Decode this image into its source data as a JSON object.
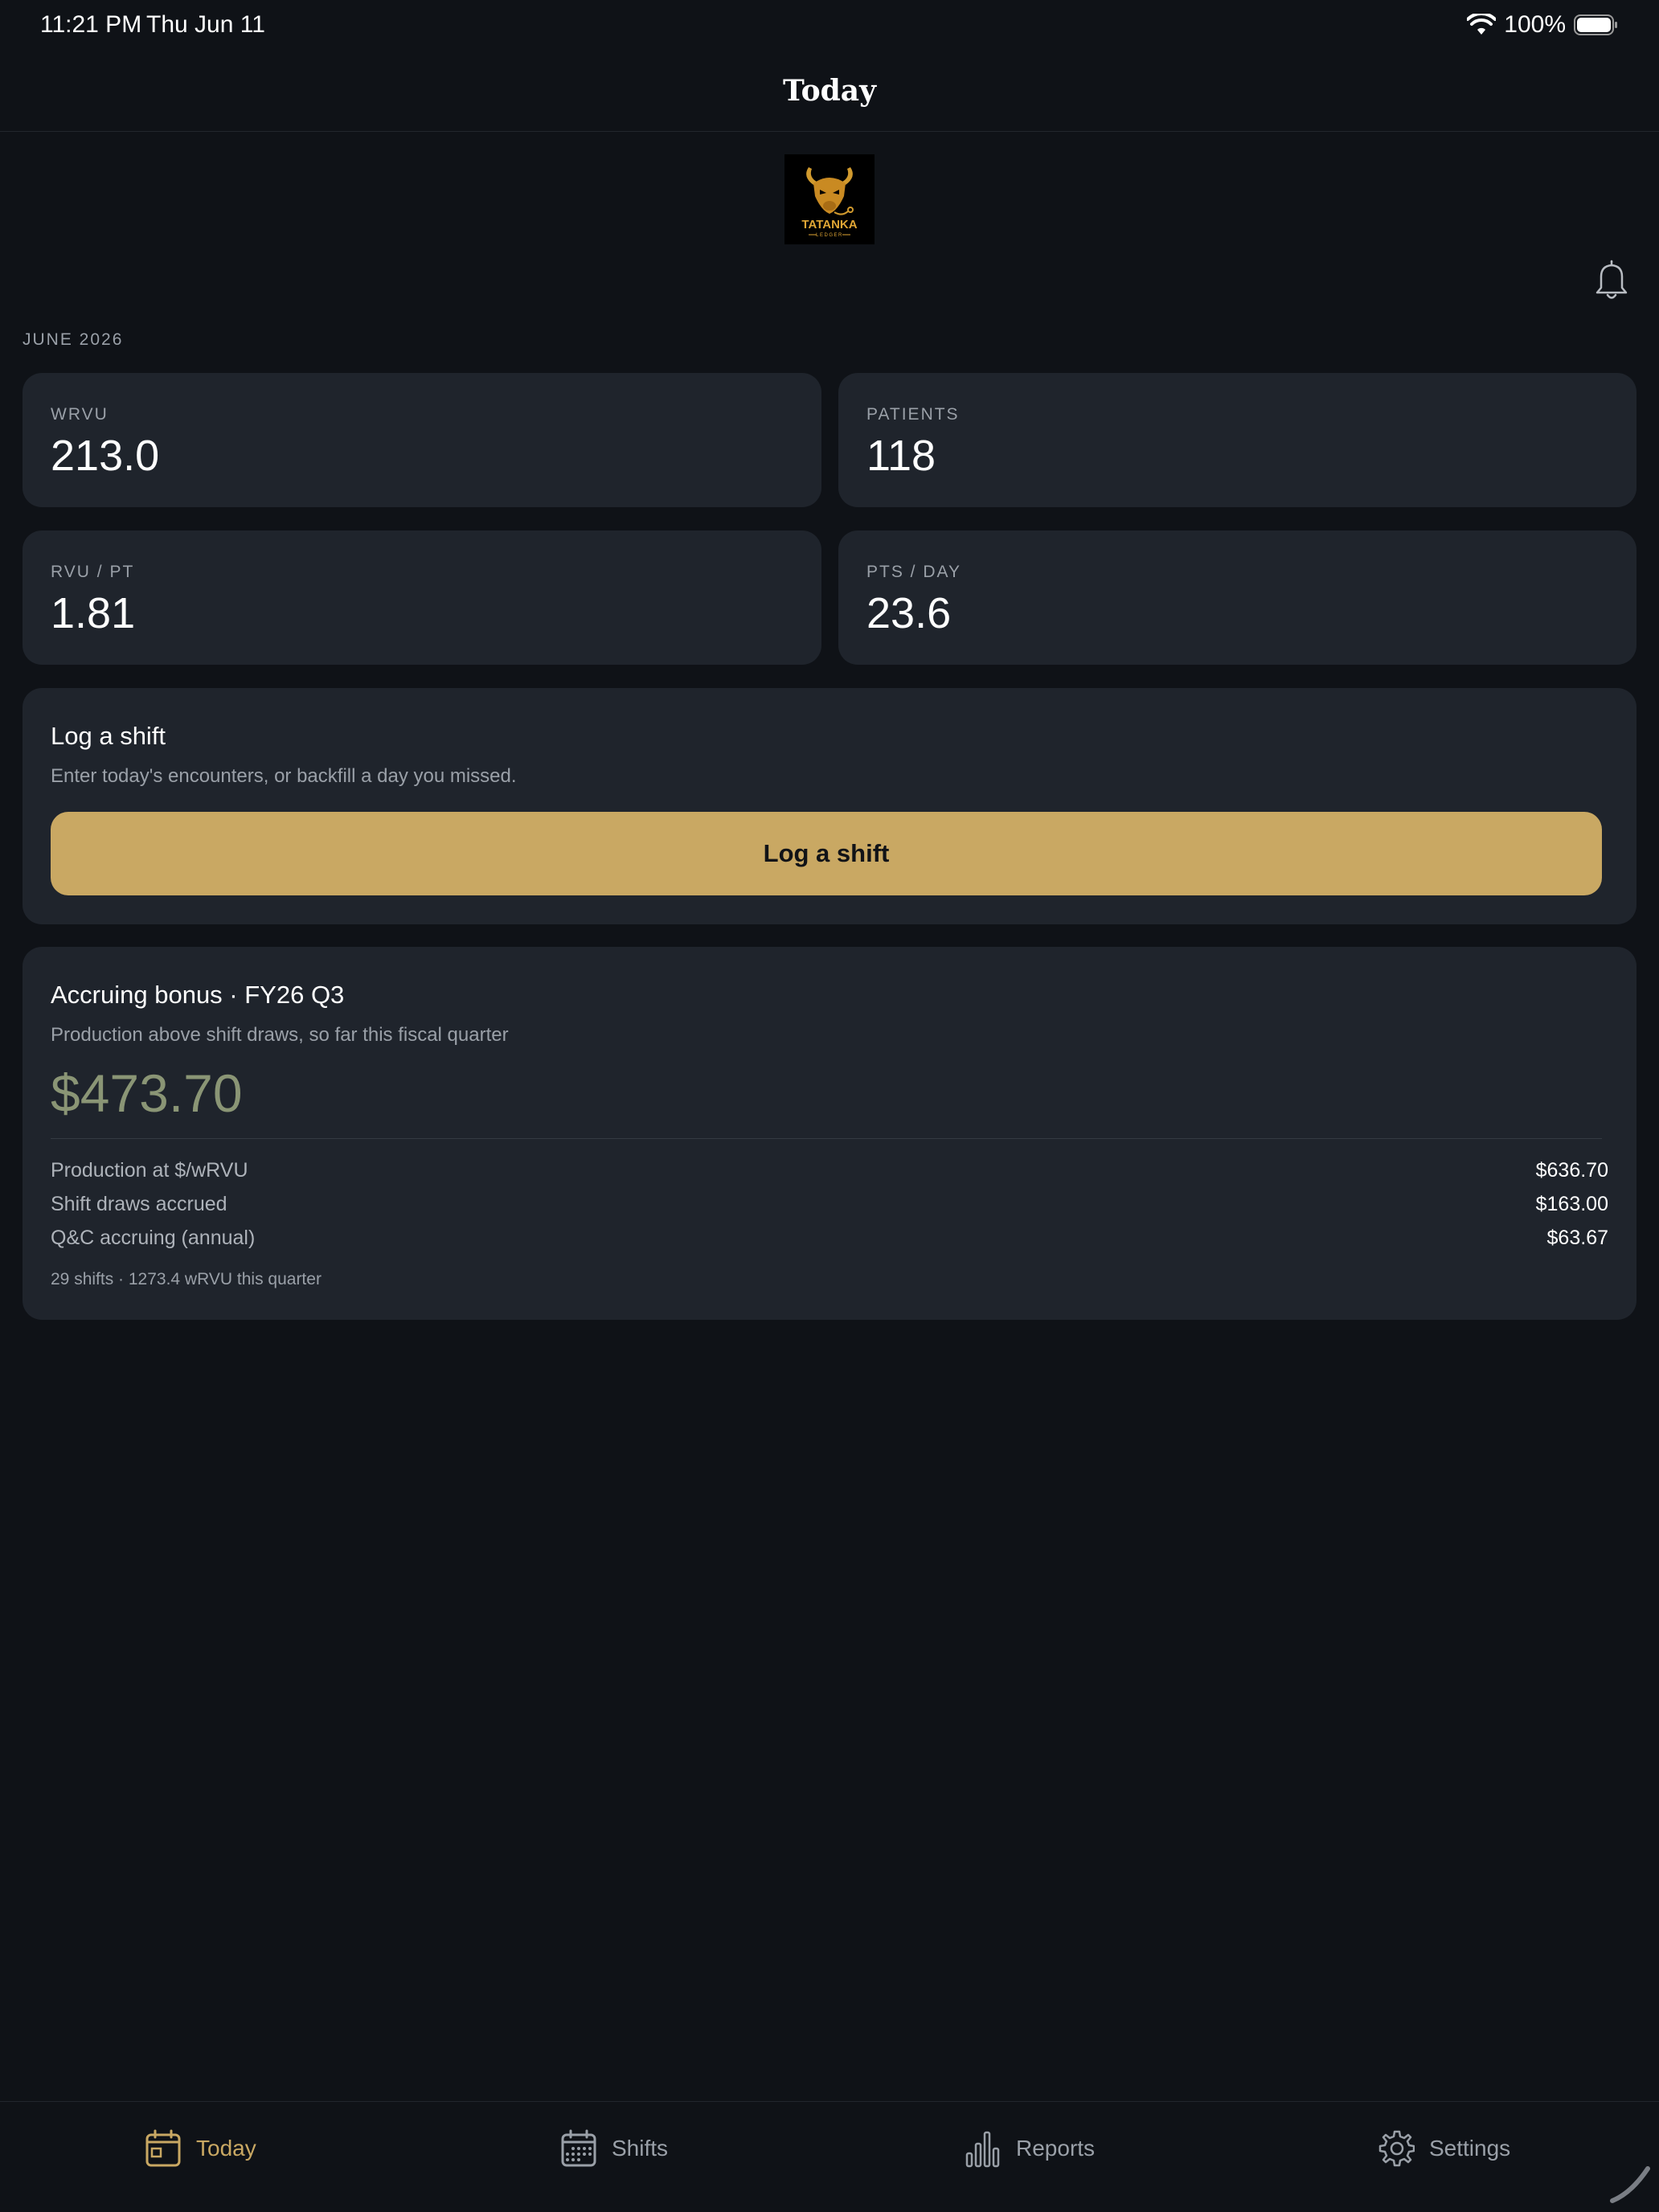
{
  "status_bar": {
    "time": "11:21 PM",
    "date": "Thu Jun 11",
    "battery": "100%"
  },
  "nav": {
    "title": "Today"
  },
  "logo": {
    "brand": "TATANKA",
    "subtitle": "LEDGER"
  },
  "month_label": "JUNE 2026",
  "stats": [
    {
      "label": "WRVU",
      "value": "213.0"
    },
    {
      "label": "PATIENTS",
      "value": "118"
    },
    {
      "label": "RVU / PT",
      "value": "1.81"
    },
    {
      "label": "PTS / DAY",
      "value": "23.6"
    }
  ],
  "log_shift": {
    "title": "Log a shift",
    "subtitle": "Enter today's encounters, or backfill a day you missed.",
    "button_label": "Log a shift"
  },
  "bonus": {
    "title": "Accruing bonus · FY26 Q3",
    "subtitle": "Production above shift draws, so far this fiscal quarter",
    "amount": "$473.70",
    "rows": [
      {
        "label": "Production at $/wRVU",
        "value": "$636.70"
      },
      {
        "label": "Shift draws accrued",
        "value": "$163.00"
      },
      {
        "label": "Q&C accruing (annual)",
        "value": "$63.67"
      }
    ],
    "footnote": "29 shifts · 1273.4 wRVU this quarter"
  },
  "tabs": [
    {
      "label": "Today",
      "icon": "calendar-today-icon",
      "active": true
    },
    {
      "label": "Shifts",
      "icon": "calendar-grid-icon",
      "active": false
    },
    {
      "label": "Reports",
      "icon": "bar-chart-icon",
      "active": false
    },
    {
      "label": "Settings",
      "icon": "gear-icon",
      "active": false
    }
  ],
  "colors": {
    "background": "#0f1217",
    "card": "#1f242c",
    "accent": "#c9a863",
    "bonus_amount": "#8a9575",
    "muted_text": "#9aa0a8"
  }
}
